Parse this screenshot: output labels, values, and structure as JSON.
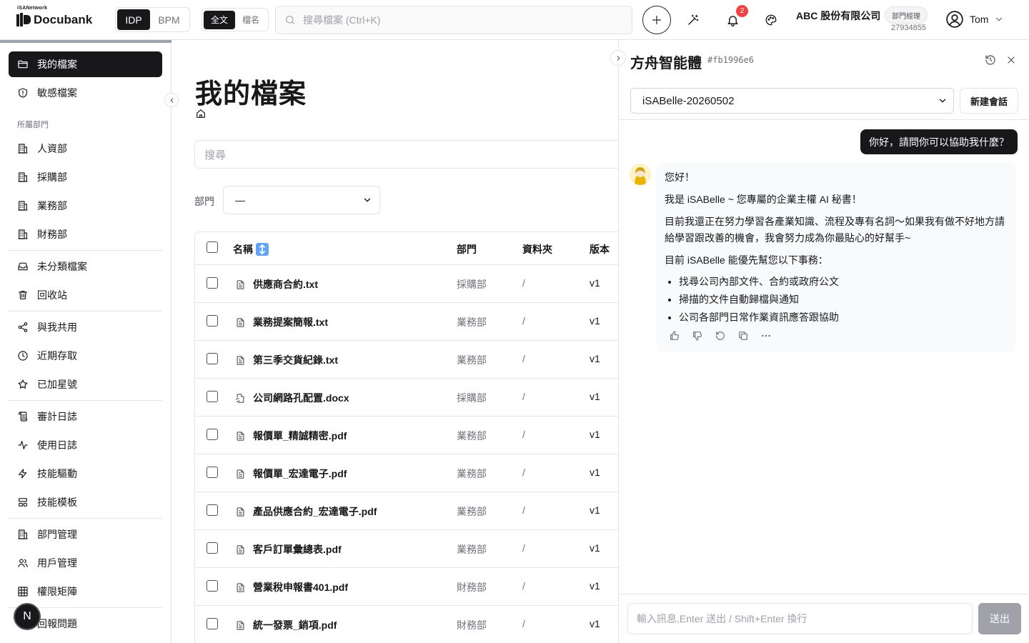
{
  "header": {
    "brand_top": "iSANetwork",
    "brand": "Docubank",
    "mode_tabs": [
      "IDP",
      "BPM"
    ],
    "search_mode_tabs": [
      "全文",
      "檔名"
    ],
    "search_placeholder": "搜尋檔案 (Ctrl+K)",
    "notification_count": "2",
    "company": "ABC 股份有限公司",
    "role": "部門經理",
    "tax_id": "27934855",
    "user_name": "Tom"
  },
  "sidebar": {
    "primary": [
      {
        "label": "我的檔案",
        "icon": "folder-icon",
        "active": true
      },
      {
        "label": "敏感檔案",
        "icon": "shield-icon"
      }
    ],
    "group_label": "所屬部門",
    "departments": [
      "人資部",
      "採購部",
      "業務部",
      "財務部"
    ],
    "misc": [
      {
        "label": "未分類檔案",
        "icon": "inbox-icon"
      },
      {
        "label": "回收站",
        "icon": "trash-icon"
      }
    ],
    "shared": [
      {
        "label": "與我共用",
        "icon": "share-icon"
      },
      {
        "label": "近期存取",
        "icon": "clock-icon"
      },
      {
        "label": "已加星號",
        "icon": "star-icon"
      }
    ],
    "logs": [
      {
        "label": "審計日誌",
        "icon": "scroll-icon"
      },
      {
        "label": "使用日誌",
        "icon": "activity-icon"
      },
      {
        "label": "技能驅動",
        "icon": "zap-icon"
      },
      {
        "label": "技能模板",
        "icon": "template-icon"
      }
    ],
    "admin": [
      {
        "label": "部門管理",
        "icon": "building-icon"
      },
      {
        "label": "用戶管理",
        "icon": "users-icon"
      },
      {
        "label": "權限矩陣",
        "icon": "grid-icon"
      }
    ],
    "report": "回報問題",
    "avatar_letter": "N"
  },
  "main": {
    "title": "我的檔案",
    "search_placeholder": "搜尋",
    "dept_label": "部門",
    "dept_value": "—",
    "columns": [
      "名稱",
      "部門",
      "資料夾",
      "版本"
    ],
    "files": [
      {
        "name": "供應商合約.txt",
        "dept": "採購部",
        "folder": "/",
        "version": "v1",
        "icon": "file-text-icon"
      },
      {
        "name": "業務提案簡報.txt",
        "dept": "業務部",
        "folder": "/",
        "version": "v1",
        "icon": "file-text-icon"
      },
      {
        "name": "第三季交貨紀錄.txt",
        "dept": "業務部",
        "folder": "/",
        "version": "v1",
        "icon": "file-text-icon"
      },
      {
        "name": "公司網路孔配置.docx",
        "dept": "採購部",
        "folder": "/",
        "version": "v1",
        "icon": "file-sync-icon"
      },
      {
        "name": "報價單_精誠精密.pdf",
        "dept": "業務部",
        "folder": "/",
        "version": "v1",
        "icon": "file-text-icon"
      },
      {
        "name": "報價單_宏達電子.pdf",
        "dept": "業務部",
        "folder": "/",
        "version": "v1",
        "icon": "file-text-icon"
      },
      {
        "name": "產品供應合約_宏達電子.pdf",
        "dept": "業務部",
        "folder": "/",
        "version": "v1",
        "icon": "file-text-icon"
      },
      {
        "name": "客戶訂單彙總表.pdf",
        "dept": "業務部",
        "folder": "/",
        "version": "v1",
        "icon": "file-text-icon"
      },
      {
        "name": "營業稅申報書401.pdf",
        "dept": "財務部",
        "folder": "/",
        "version": "v1",
        "icon": "file-text-icon"
      },
      {
        "name": "統一發票_銷項.pdf",
        "dept": "財務部",
        "folder": "/",
        "version": "v1",
        "icon": "file-text-icon"
      }
    ]
  },
  "chat": {
    "title": "方舟智能體",
    "session_id": "#fb1996e6",
    "session": "iSABelle-20260502",
    "new_chat": "新建會話",
    "user_message": "你好，請問你可以協助我什麼？",
    "bot_paragraphs": [
      "您好！",
      "我是 iSABelle ~ 您專屬的企業主權 AI 秘書！",
      "目前我還正在努力學習各產業知識、流程及專有名詞～如果我有做不好地方請給學習跟改善的機會，我會努力成為你最貼心的好幫手~",
      "目前 iSABelle 能優先幫您以下事務："
    ],
    "bot_list": [
      "找尋公司內部文件、合約或政府公文",
      "掃描的文件自動歸檔與通知",
      "公司各部門日常作業資訊應答跟協助"
    ],
    "input_placeholder": "輸入訊息,Enter 送出 / Shift+Enter 換行",
    "send": "送出"
  }
}
